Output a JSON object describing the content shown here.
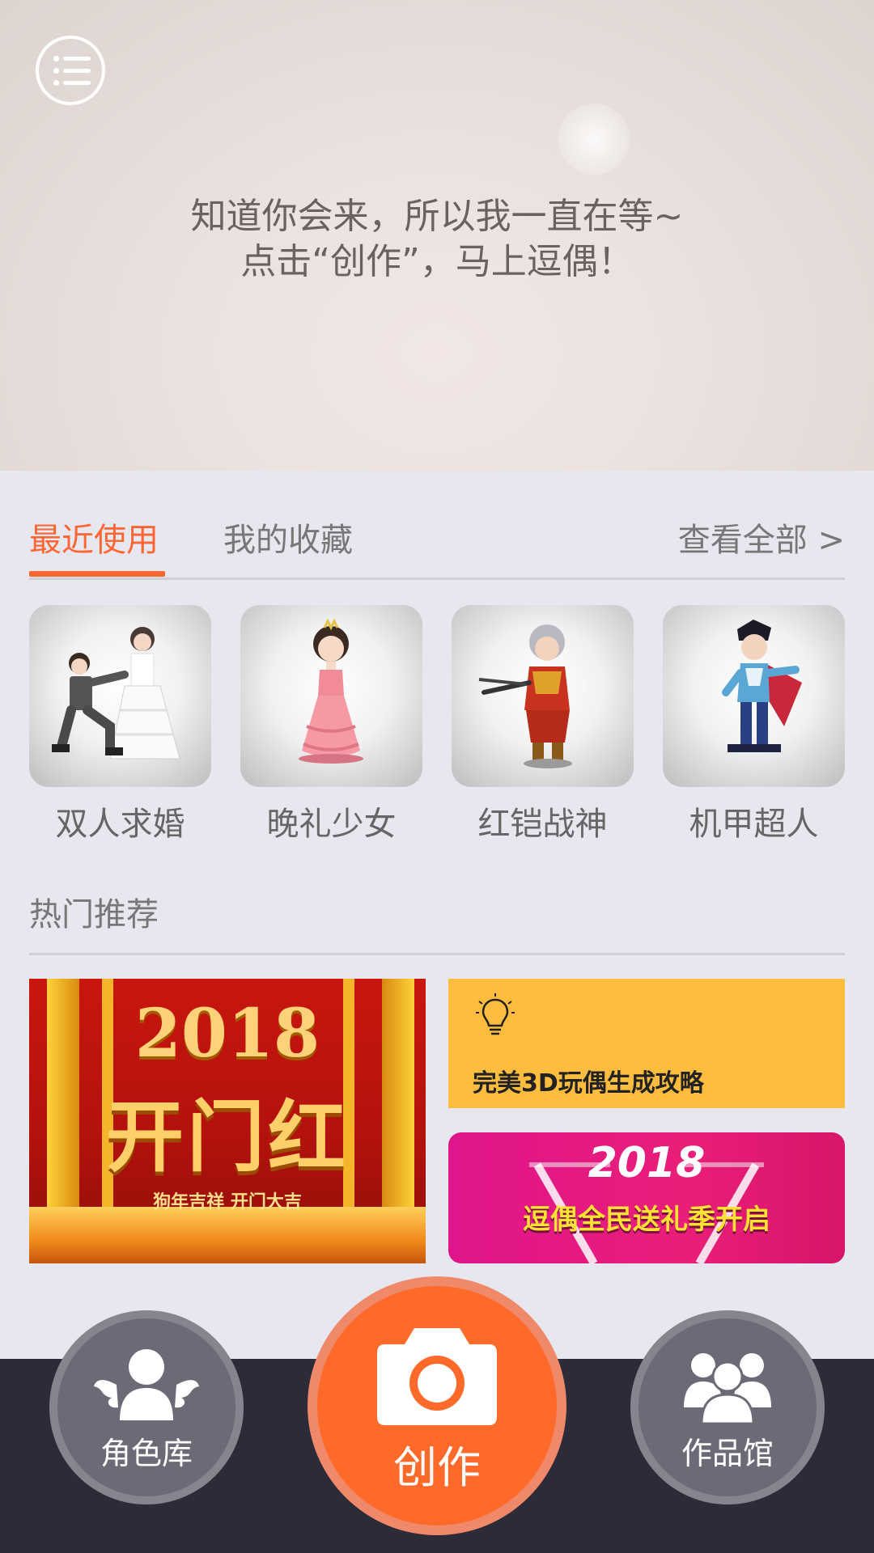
{
  "hero": {
    "line1": "知道你会来，所以我一直在等~",
    "line2": "点击“创作”，马上逗偶！"
  },
  "tabs": [
    {
      "label": "最近使用",
      "active": true
    },
    {
      "label": "我的收藏",
      "active": false
    }
  ],
  "view_all": "查看全部 >",
  "recent": [
    {
      "label": "双人求婚"
    },
    {
      "label": "晚礼少女"
    },
    {
      "label": "红铠战神"
    },
    {
      "label": "机甲超人"
    }
  ],
  "hot": {
    "title": "热门推荐",
    "banner_main": {
      "year": "2018",
      "headline": "开门红",
      "subline": "狗年吉祥 开门大吉"
    },
    "guide": {
      "icon": "lightbulb-icon",
      "text": "完美3D玩偶生成攻略"
    },
    "gift": {
      "year": "2018",
      "text": "逗偶全民送礼季开启"
    }
  },
  "bottom_nav": {
    "left": {
      "label": "角色库",
      "icon": "angel-user-icon"
    },
    "center": {
      "label": "创作",
      "icon": "camera-icon"
    },
    "right": {
      "label": "作品馆",
      "icon": "group-users-icon"
    }
  },
  "colors": {
    "accent": "#ff6633",
    "nav_bar": "#2c2b37",
    "guide_card": "#ffbd40",
    "gift_card": "#e0158c"
  }
}
